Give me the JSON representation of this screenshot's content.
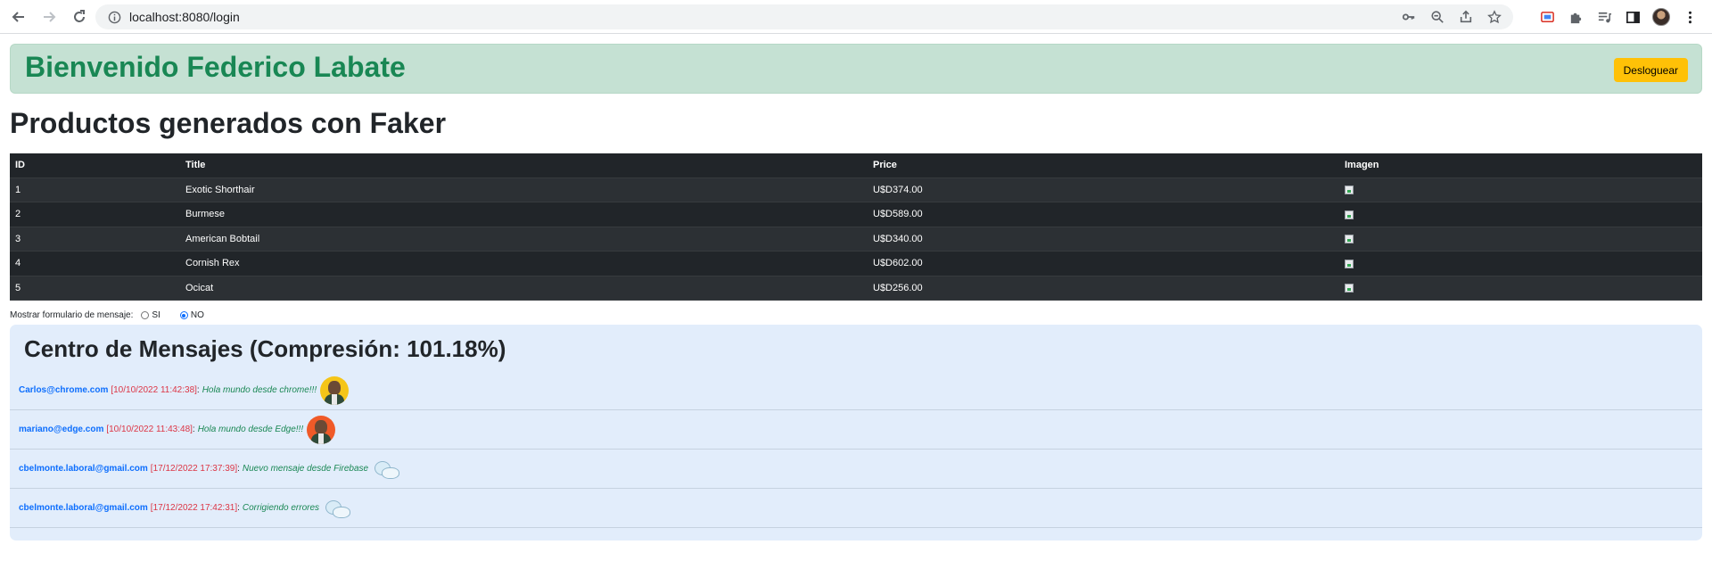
{
  "browser": {
    "url": "localhost:8080/login",
    "icons": [
      "back-icon",
      "forward-icon",
      "reload-icon",
      "info-icon",
      "key-icon",
      "zoom-icon",
      "share-icon",
      "star-icon",
      "cast-icon",
      "puzzle-icon",
      "media-icon",
      "sidepanel-icon",
      "profile-avatar",
      "menu-icon"
    ]
  },
  "header": {
    "welcome": "Bienvenido Federico Labate",
    "logout_label": "Desloguear",
    "colors": {
      "banner_bg": "#c5e1d3",
      "title": "#198754",
      "logout_bg": "#ffc107"
    }
  },
  "products": {
    "title": "Productos generados con Faker",
    "columns": [
      "ID",
      "Title",
      "Price",
      "Imagen"
    ],
    "rows": [
      {
        "id": "1",
        "title": "Exotic Shorthair",
        "price": "U$D374.00"
      },
      {
        "id": "2",
        "title": "Burmese",
        "price": "U$D589.00"
      },
      {
        "id": "3",
        "title": "American Bobtail",
        "price": "U$D340.00"
      },
      {
        "id": "4",
        "title": "Cornish Rex",
        "price": "U$D602.00"
      },
      {
        "id": "5",
        "title": "Ocicat",
        "price": "U$D256.00"
      }
    ]
  },
  "message_form_toggle": {
    "label": "Mostrar formulario de mensaje:",
    "options": [
      {
        "label": "SI",
        "checked": false
      },
      {
        "label": "NO",
        "checked": true
      }
    ]
  },
  "messages": {
    "title": "Centro de Mensajes (Compresión: 101.18%)",
    "items": [
      {
        "email": "Carlos@chrome.com",
        "date": "[10/10/2022 11:42:38]",
        "text": "Hola mundo desde chrome!!!",
        "avatar": "yellow-person-avatar"
      },
      {
        "email": "mariano@edge.com",
        "date": "[10/10/2022 11:43:48]",
        "text": "Hola mundo desde Edge!!!",
        "avatar": "orange-person-avatar"
      },
      {
        "email": "cbelmonte.laboral@gmail.com",
        "date": "[17/12/2022 17:37:39]",
        "text": "Nuevo mensaje desde Firebase",
        "avatar": "baby-avatar"
      },
      {
        "email": "cbelmonte.laboral@gmail.com",
        "date": "[17/12/2022 17:42:31]",
        "text": "Corrigiendo errores",
        "avatar": "baby-avatar"
      }
    ]
  }
}
